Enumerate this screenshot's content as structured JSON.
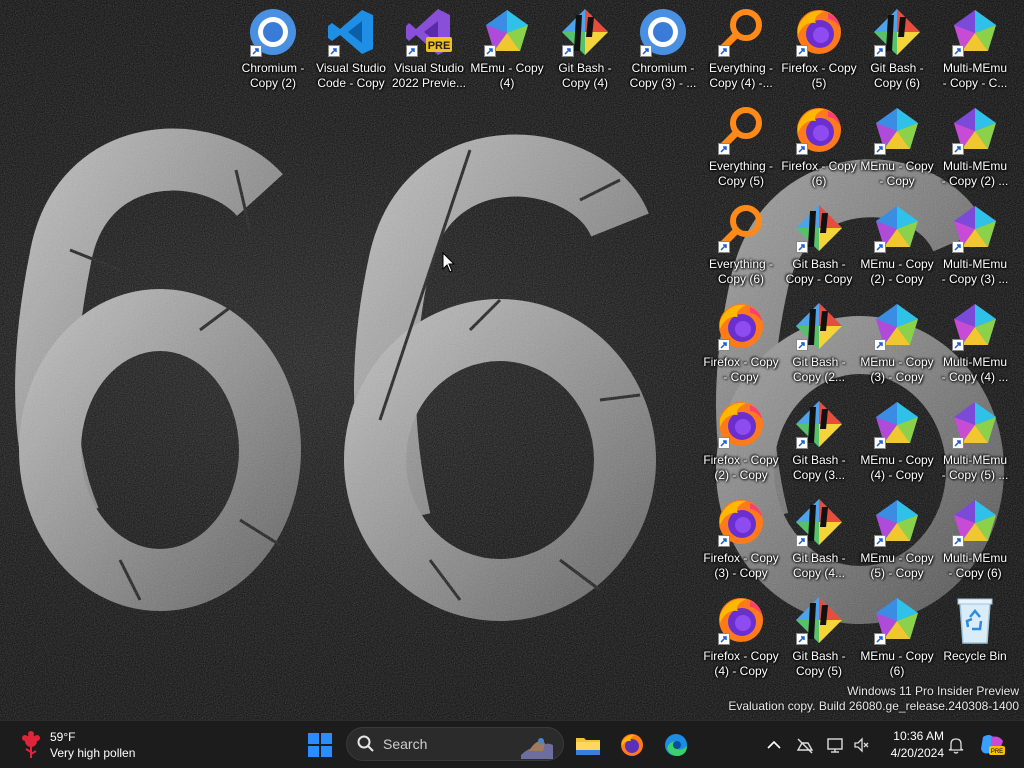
{
  "desktop": {
    "icons": [
      {
        "label": "Chromium -\nCopy (2)",
        "icon": "chromium-icon"
      },
      {
        "label": "Visual Studio\nCode - Copy",
        "icon": "vscode-icon"
      },
      {
        "label": "Visual Studio\n2022 Previe...",
        "icon": "visual-studio-preview-icon"
      },
      {
        "label": "MEmu - Copy\n(4)",
        "icon": "memu-icon"
      },
      {
        "label": "Git Bash -\nCopy (4)",
        "icon": "git-bash-icon"
      },
      {
        "label": "Chromium -\nCopy (3) - ...",
        "icon": "chromium-icon"
      },
      {
        "label": "Everything -\nCopy (4) -...",
        "icon": "everything-icon"
      },
      {
        "label": "Firefox - Copy\n(5)",
        "icon": "firefox-icon"
      },
      {
        "label": "Git Bash -\nCopy (6)",
        "icon": "git-bash-icon"
      },
      {
        "label": "Multi-MEmu\n- Copy - C...",
        "icon": "multi-memu-icon"
      },
      {
        "label": "Everything -\nCopy (5)",
        "icon": "everything-icon"
      },
      {
        "label": "Firefox - Copy\n(6)",
        "icon": "firefox-icon"
      },
      {
        "label": "MEmu - Copy\n- Copy",
        "icon": "memu-icon"
      },
      {
        "label": "Multi-MEmu\n- Copy (2) ...",
        "icon": "multi-memu-icon"
      },
      {
        "label": "Everything -\nCopy (6)",
        "icon": "everything-icon"
      },
      {
        "label": "Git Bash -\nCopy - Copy",
        "icon": "git-bash-icon"
      },
      {
        "label": "MEmu - Copy\n(2) - Copy",
        "icon": "memu-icon"
      },
      {
        "label": "Multi-MEmu\n- Copy (3) ...",
        "icon": "multi-memu-icon"
      },
      {
        "label": "Firefox - Copy\n- Copy",
        "icon": "firefox-icon"
      },
      {
        "label": "Git Bash -\nCopy (2...",
        "icon": "git-bash-icon"
      },
      {
        "label": "MEmu - Copy\n(3) - Copy",
        "icon": "memu-icon"
      },
      {
        "label": "Multi-MEmu\n- Copy (4) ...",
        "icon": "multi-memu-icon"
      },
      {
        "label": "Firefox - Copy\n(2) - Copy",
        "icon": "firefox-icon"
      },
      {
        "label": "Git Bash -\nCopy (3...",
        "icon": "git-bash-icon"
      },
      {
        "label": "MEmu - Copy\n(4) - Copy",
        "icon": "memu-icon"
      },
      {
        "label": "Multi-MEmu\n- Copy (5) ...",
        "icon": "multi-memu-icon"
      },
      {
        "label": "Firefox - Copy\n(3) - Copy",
        "icon": "firefox-icon"
      },
      {
        "label": "Git Bash -\nCopy (4...",
        "icon": "git-bash-icon"
      },
      {
        "label": "MEmu - Copy\n(5) - Copy",
        "icon": "memu-icon"
      },
      {
        "label": "Multi-MEmu\n- Copy (6)",
        "icon": "multi-memu-icon"
      },
      {
        "label": "Firefox - Copy\n(4) - Copy",
        "icon": "firefox-icon"
      },
      {
        "label": "Git Bash -\nCopy (5)",
        "icon": "git-bash-icon"
      },
      {
        "label": "MEmu - Copy\n(6)",
        "icon": "memu-icon"
      },
      {
        "label": "Recycle Bin",
        "icon": "recycle-bin-icon"
      }
    ],
    "watermark_line1": "Windows 11 Pro Insider Preview",
    "watermark_line2": "Evaluation copy. Build 26080.ge_release.240308-1400"
  },
  "taskbar": {
    "weather_temp": "59°F",
    "weather_desc": "Very high pollen",
    "search_label": "Search",
    "pinned": [
      "start-icon",
      "file-explorer-icon",
      "firefox-icon",
      "edge-icon"
    ],
    "time": "10:36 AM",
    "date": "4/20/2024"
  },
  "colors": {
    "taskbar_bg": "#1c1c1c",
    "start_blue": "#2b8cff",
    "folder_yellow": "#f7c23a"
  }
}
